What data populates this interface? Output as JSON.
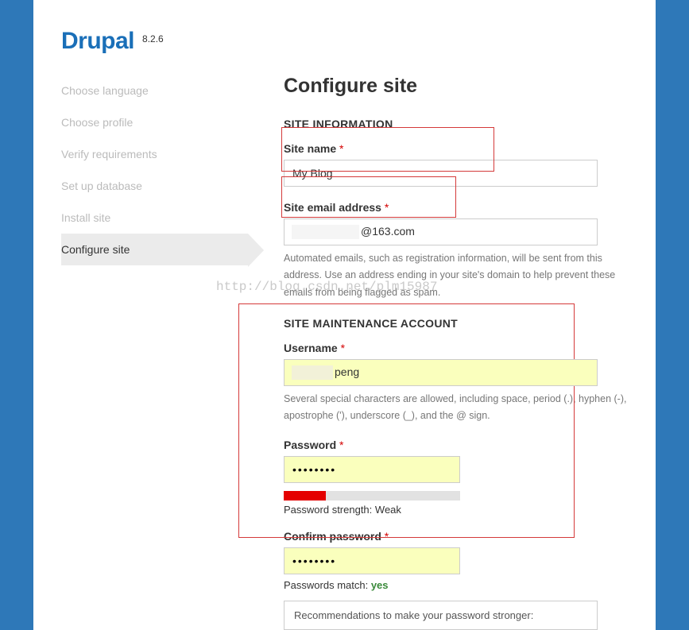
{
  "brand": "Drupal",
  "version": "8.2.6",
  "watermark": "http://blog.csdn.net/plm15987",
  "sidebar": {
    "items": [
      {
        "label": "Choose language",
        "active": false
      },
      {
        "label": "Choose profile",
        "active": false
      },
      {
        "label": "Verify requirements",
        "active": false
      },
      {
        "label": "Set up database",
        "active": false
      },
      {
        "label": "Install site",
        "active": false
      },
      {
        "label": "Configure site",
        "active": true
      }
    ]
  },
  "main": {
    "title": "Configure site",
    "section_site_info": "SITE INFORMATION",
    "section_maint": "SITE MAINTENANCE ACCOUNT",
    "site_name": {
      "label": "Site name",
      "value": "My Blog"
    },
    "site_email": {
      "label": "Site email address",
      "value_suffix": "@163.com",
      "help": "Automated emails, such as registration information, will be sent from this address. Use an address ending in your site's domain to help prevent these emails from being flagged as spam."
    },
    "username": {
      "label": "Username",
      "value_suffix": "peng",
      "help": "Several special characters are allowed, including space, period (.), hyphen (-), apostrophe ('), underscore (_), and the @ sign."
    },
    "password": {
      "label": "Password",
      "value": "••••••••",
      "strength_label": "Password strength:",
      "strength_value": "Weak"
    },
    "confirm": {
      "label": "Confirm password",
      "value": "••••••••",
      "match_label": "Passwords match:",
      "match_value": "yes"
    },
    "reco": "Recommendations to make your password stronger:"
  }
}
